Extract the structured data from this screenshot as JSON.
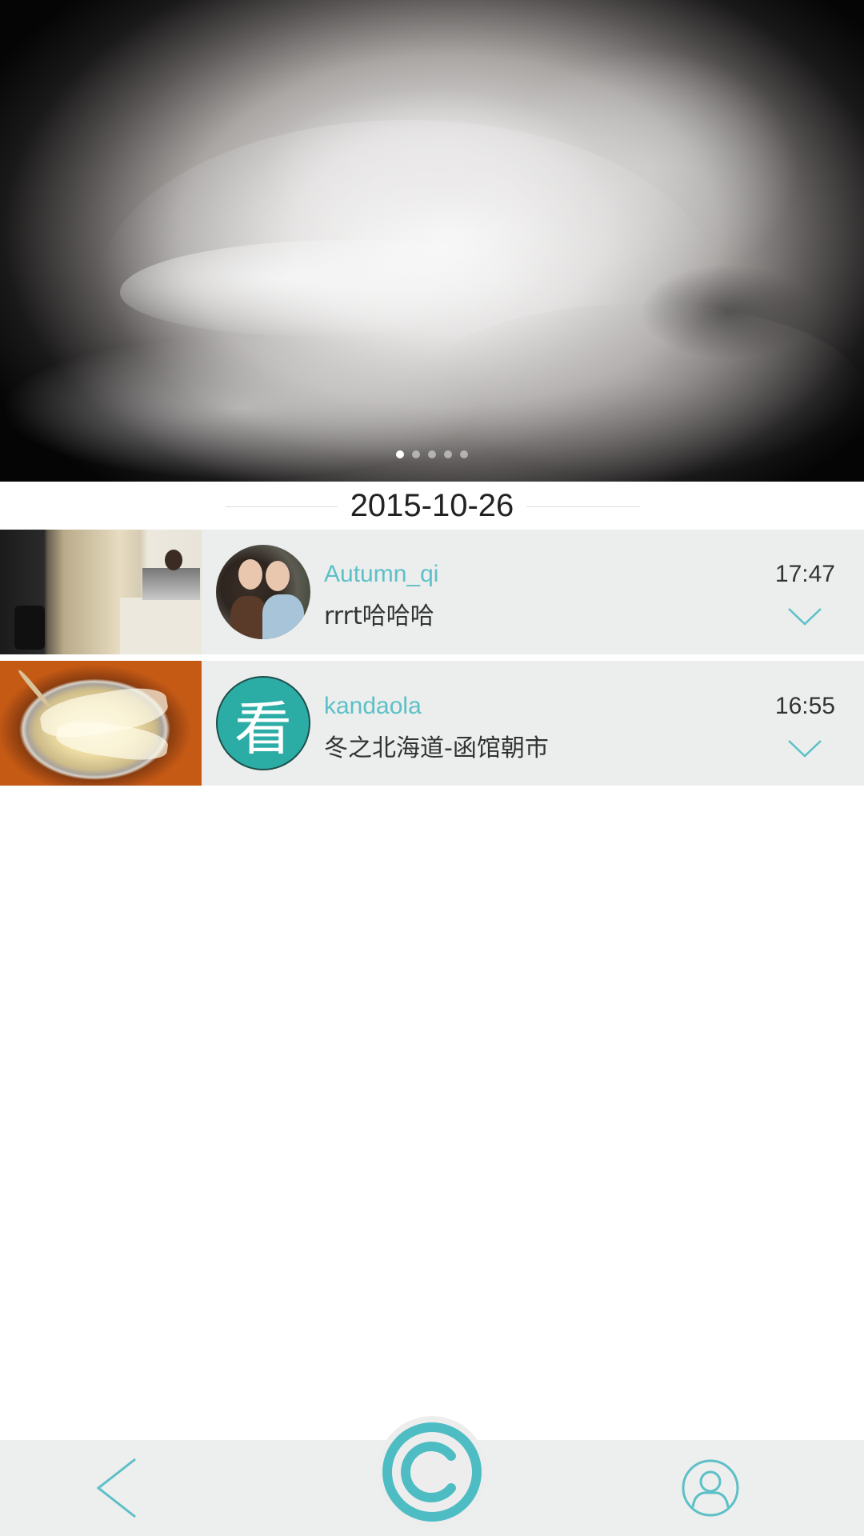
{
  "banner": {
    "image": "white-rose-photo",
    "page_count": 5,
    "active_page": 1
  },
  "date_header": "2015-10-26",
  "feed": [
    {
      "username": "Autumn_qi",
      "message": "rrrt哈哈哈",
      "time": "17:47",
      "thumbnail": "office-reception-photo",
      "avatar": "two-girls-selfie"
    },
    {
      "username": "kandaola",
      "message": "冬之北海道-函馆朝市",
      "time": "16:55",
      "thumbnail": "noodle-dish-photo",
      "avatar": "kandaola-logo",
      "avatar_glyph": "看"
    }
  ],
  "bottom_nav": {
    "back": "back-chevron-icon",
    "home": "kandaola-c-logo-icon",
    "profile": "user-profile-icon"
  },
  "colors": {
    "accent": "#5cc0c6",
    "logo_teal": "#2bada6",
    "item_bg": "#eceeee",
    "nav_bg": "#edeeee"
  }
}
